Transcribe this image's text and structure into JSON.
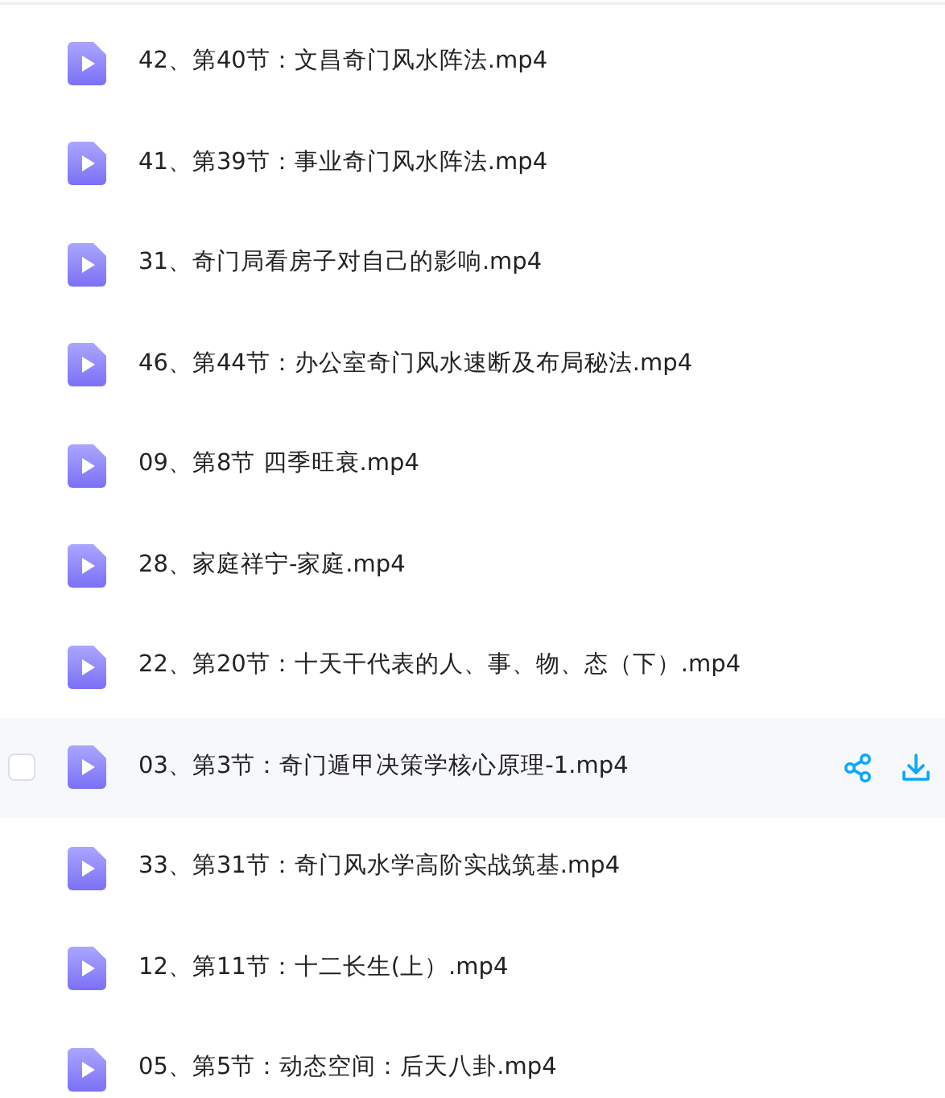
{
  "files": [
    {
      "name": "42、第40节：文昌奇门风水阵法.mp4",
      "hovered": false
    },
    {
      "name": "41、第39节：事业奇门风水阵法.mp4",
      "hovered": false
    },
    {
      "name": "31、奇门局看房子对自己的影响.mp4",
      "hovered": false
    },
    {
      "name": "46、第44节：办公室奇门风水速断及布局秘法.mp4",
      "hovered": false
    },
    {
      "name": "09、第8节 四季旺衰.mp4",
      "hovered": false
    },
    {
      "name": "28、家庭祥宁-家庭.mp4",
      "hovered": false
    },
    {
      "name": "22、第20节：十天干代表的人、事、物、态（下）.mp4",
      "hovered": false
    },
    {
      "name": "03、第3节：奇门遁甲决策学核心原理-1.mp4",
      "hovered": true,
      "checked": false
    },
    {
      "name": "33、第31节：奇门风水学高阶实战筑基.mp4",
      "hovered": false
    },
    {
      "name": "12、第11节：十二长生(上）.mp4",
      "hovered": false
    },
    {
      "name": "05、第5节：动态空间：后天八卦.mp4",
      "hovered": false
    }
  ]
}
